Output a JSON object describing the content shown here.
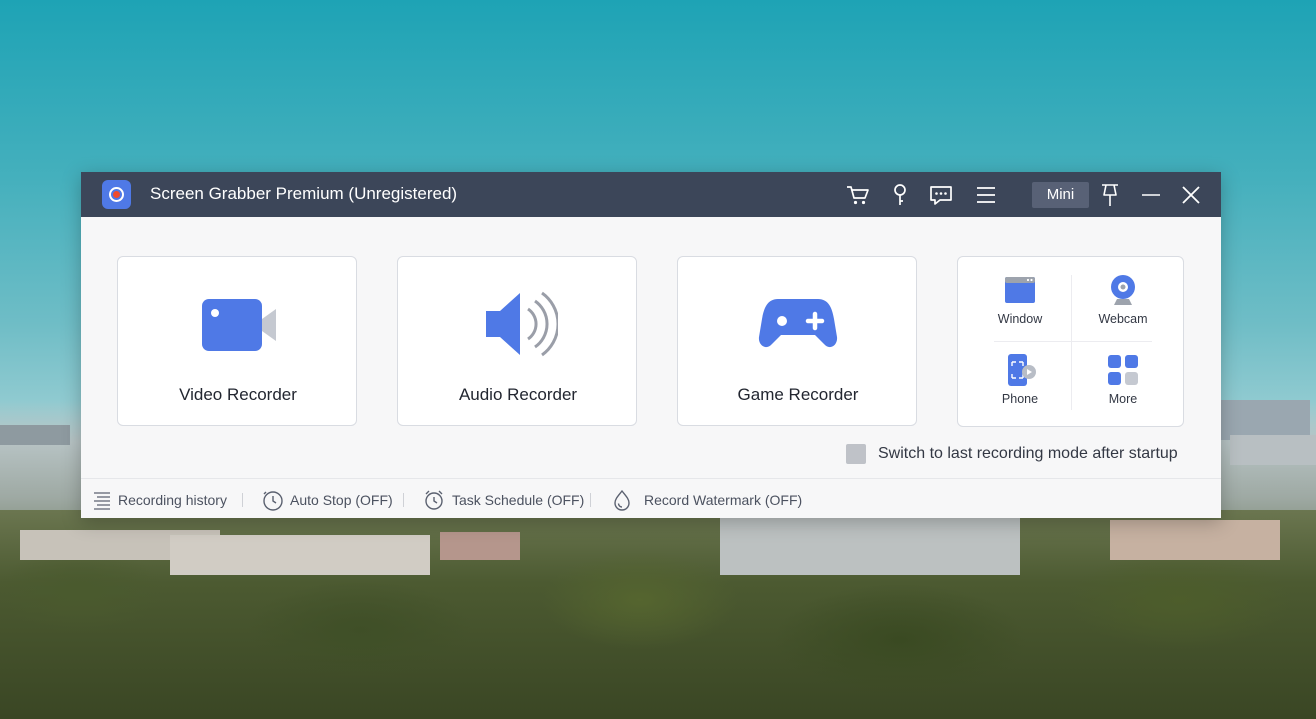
{
  "window": {
    "title": "Screen Grabber Premium (Unregistered)",
    "mini_label": "Mini",
    "icons": [
      "cart-icon",
      "key-icon",
      "feedback-icon",
      "menu-icon",
      "pin-icon",
      "minimize-icon",
      "close-icon"
    ],
    "accent": "#4f79e6",
    "titlebar_color": "#3c4659"
  },
  "recorders": [
    {
      "label": "Video Recorder",
      "icon": "video-camera-icon"
    },
    {
      "label": "Audio Recorder",
      "icon": "speaker-icon"
    },
    {
      "label": "Game Recorder",
      "icon": "gamepad-icon"
    }
  ],
  "more_tools": [
    {
      "label": "Window",
      "icon": "window-icon"
    },
    {
      "label": "Webcam",
      "icon": "webcam-icon"
    },
    {
      "label": "Phone",
      "icon": "phone-icon"
    },
    {
      "label": "More",
      "icon": "grid-icon"
    }
  ],
  "startup_option": {
    "label": "Switch to last recording mode after startup",
    "checked": false
  },
  "statusbar": [
    {
      "label": "Recording history",
      "icon": "list-icon"
    },
    {
      "label": "Auto Stop (OFF)",
      "icon": "clock-icon"
    },
    {
      "label": "Task Schedule (OFF)",
      "icon": "alarm-icon"
    },
    {
      "label": "Record Watermark (OFF)",
      "icon": "droplet-icon"
    }
  ]
}
